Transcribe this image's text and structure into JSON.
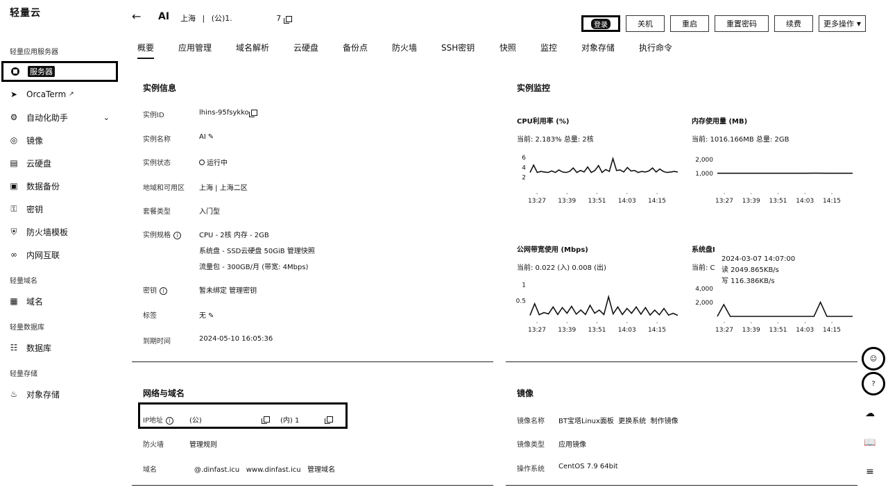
{
  "sidebar": {
    "brand": "轻量云",
    "section_servers": "轻量应用服务器",
    "items": [
      {
        "label": "服务器",
        "icon": "server-icon"
      },
      {
        "label": "OrcaTerm",
        "icon": "terminal-icon"
      },
      {
        "label": "自动化助手",
        "icon": "robot-icon"
      },
      {
        "label": "镜像",
        "icon": "disc-icon"
      },
      {
        "label": "云硬盘",
        "icon": "disk-icon"
      },
      {
        "label": "数据备份",
        "icon": "backup-icon"
      },
      {
        "label": "密钥",
        "icon": "key-icon"
      },
      {
        "label": "防火墙模板",
        "icon": "shield-icon"
      },
      {
        "label": "内网互联",
        "icon": "link-icon"
      }
    ],
    "section_domain": "轻量域名",
    "domain_item": "域名",
    "section_db": "轻量数据库",
    "db_item": "数据库",
    "section_storage": "轻量存储",
    "storage_item": "对象存储"
  },
  "header": {
    "back": "←",
    "instance_name": "AI",
    "region": "上海",
    "sep": "|",
    "ip_public": "(公)1.",
    "ip_tail": "7",
    "buttons": {
      "login": "登录",
      "shutdown": "关机",
      "restart": "重启",
      "reset_password": "重置密码",
      "renew": "续费",
      "more": "更多操作"
    }
  },
  "tabs": [
    "概要",
    "应用管理",
    "域名解析",
    "云硬盘",
    "备份点",
    "防火墙",
    "SSH密钥",
    "快照",
    "监控",
    "对象存储",
    "执行命令"
  ],
  "instance_info": {
    "title": "实例信息",
    "rows": [
      {
        "label": "实例ID",
        "value": "lhins-95fsykko"
      },
      {
        "label": "实例名称",
        "value": "AI"
      },
      {
        "label": "实例状态",
        "value": "运行中"
      },
      {
        "label": "地域和可用区",
        "value": "上海  |  上海二区"
      },
      {
        "label": "套餐类型",
        "value": "入门型"
      },
      {
        "label": "实例规格",
        "value": "CPU - 2核 内存 - 2GB"
      },
      {
        "label": "密钥",
        "value": "暂未绑定  管理密钥"
      },
      {
        "label": "标签",
        "value": "无"
      },
      {
        "label": "到期时间",
        "value": "2024-05-10 16:05:36"
      }
    ],
    "spec_line2": "系统盘 - SSD云硬盘 50GiB  管理快照",
    "spec_line3": "流量包 - 300GB/月 (带宽: 4Mbps)"
  },
  "monitor": {
    "title": "实例监控",
    "cpu_title": "CPU利用率 (%)",
    "cpu_current": "当前: 2.183% 总量: 2核",
    "mem_title": "内存使用量 (MB)",
    "mem_current": "当前: 1016.166MB 总量: 2GB",
    "net_title": "公网带宽使用 (Mbps)",
    "net_current": "当前: 0.022 (入) 0.008 (出)",
    "disk_title": "系统盘I",
    "disk_current": "当前: C",
    "tooltip_time": "2024-03-07 14:07:00",
    "tooltip_read": "读 2049.865KB/s",
    "tooltip_write": "写 116.386KB/s"
  },
  "chart_data": [
    {
      "type": "line",
      "title": "CPU利用率 (%)",
      "x_ticks": [
        "13:27",
        "13:39",
        "13:51",
        "14:03",
        "14:15"
      ],
      "y_ticks": [
        "6",
        "4",
        "2"
      ],
      "ylim": [
        0,
        7
      ],
      "values": [
        3,
        4.5,
        3,
        3.2,
        3.1,
        3,
        3.3,
        3,
        3.5,
        3.1,
        3,
        3.2,
        3.9,
        3,
        3.4,
        3.1,
        4.1,
        3,
        3.4,
        4.4,
        3,
        3.6,
        3.2,
        5.8,
        3.4,
        3.5,
        3.1,
        4,
        3.3,
        3.4,
        3,
        3.2,
        3.1,
        3.3,
        3.9,
        3.1,
        3.7,
        3.2,
        3,
        3.1,
        3.2,
        3.1
      ]
    },
    {
      "type": "line",
      "title": "内存使用量 (MB)",
      "x_ticks": [
        "13:27",
        "13:39",
        "13:51",
        "14:03",
        "14:15"
      ],
      "y_ticks": [
        "2,000",
        "1,000"
      ],
      "ylim": [
        0,
        2500
      ],
      "values": [
        1016,
        1016,
        1016,
        1016,
        1017,
        1016,
        1016,
        1016,
        1018,
        1016,
        1016,
        1016
      ]
    },
    {
      "type": "line",
      "title": "公网带宽使用 (Mbps)",
      "x_ticks": [
        "13:27",
        "13:39",
        "13:51",
        "14:03",
        "14:15"
      ],
      "y_ticks": [
        "1",
        "0.5"
      ],
      "ylim": [
        0,
        1.1
      ],
      "values": [
        0.03,
        0.4,
        0.05,
        0.12,
        0.08,
        0.3,
        0.06,
        0.28,
        0.1,
        0.32,
        0.07,
        0.2,
        0.06,
        0.35,
        0.1,
        0.2,
        0.06,
        0.62,
        0.08,
        0.3,
        0.06,
        0.25,
        0.1,
        0.3,
        0.07,
        0.28,
        0.04,
        0.2,
        0.05,
        0.25,
        0.04,
        0.1,
        0.03
      ]
    },
    {
      "type": "line",
      "title": "系统盘I",
      "x_ticks": [
        "13:27",
        "13:39",
        "13:51",
        "14:03",
        "14:15"
      ],
      "y_ticks": [
        "4,000",
        "2,000"
      ],
      "ylim": [
        0,
        5000
      ],
      "values": [
        0,
        1700,
        0,
        0,
        0,
        0,
        0,
        0,
        0,
        0,
        0,
        0,
        0,
        0,
        0,
        0,
        2049,
        0,
        0,
        0,
        0,
        0
      ]
    }
  ],
  "network": {
    "title": "网络与域名",
    "ip_label": "IP地址",
    "ip_public": "(公)",
    "ip_inner": "(内) 1",
    "firewall_label": "防火墙",
    "firewall_value": "管理规则",
    "domain_label": "域名",
    "domain_value": "@.dinfast.icu   www.dinfast.icu   管理域名"
  },
  "image": {
    "title": "镜像",
    "name_label": "镜像名称",
    "name_value": "BT宝塔Linux面板  更换系统  制作镜像",
    "type_label": "镜像类型",
    "type_value": "应用镜像",
    "os_label": "操作系统",
    "os_value": "CentOS 7.9 64bit"
  },
  "float_tools": {
    "chat": "☺",
    "help": "?",
    "cloud": "☁",
    "book": "📖",
    "list": "≡"
  }
}
